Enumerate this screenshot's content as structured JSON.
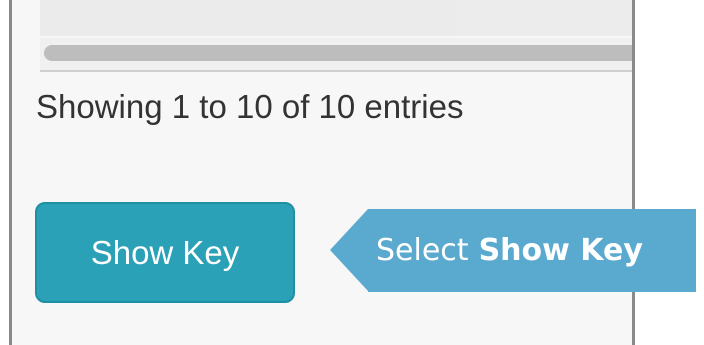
{
  "table": {
    "info_text": "Showing 1 to 10 of 10 entries"
  },
  "actions": {
    "show_key_label": "Show Key"
  },
  "callout": {
    "prefix": "Select",
    "emphasis": "Show Key",
    "color": "#5aa9cf"
  },
  "colors": {
    "button": "#2aa1b6",
    "frame_border": "#8a8a8a"
  }
}
